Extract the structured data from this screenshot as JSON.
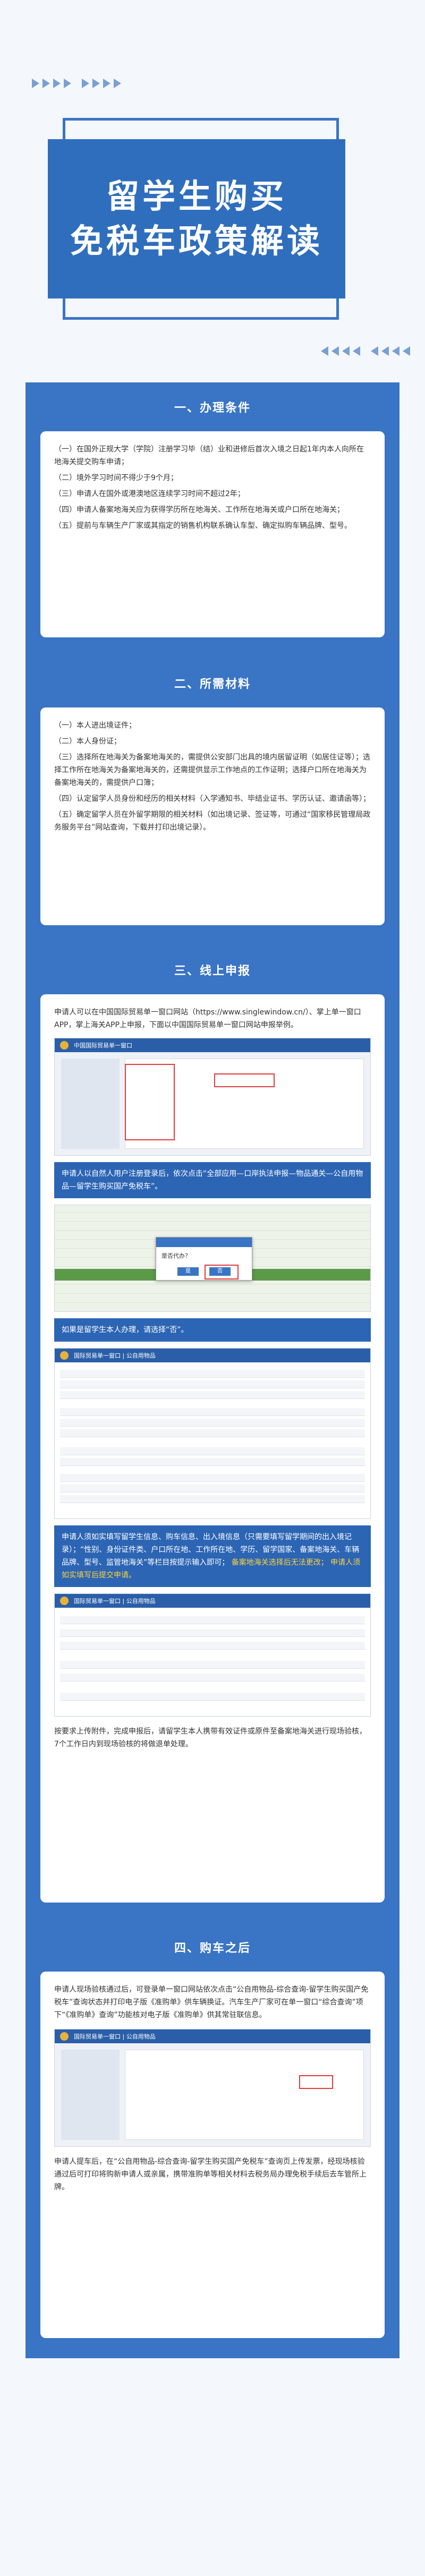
{
  "title": {
    "line1": "留学生购买",
    "line2": "免税车政策解读"
  },
  "sections": [
    {
      "heading": "一、办理条件",
      "paragraphs": [
        "（一）在国外正规大学（学院）注册学习毕（结）业和进修后首次入境之日起1年内本人向所在地海关提交购车申请；",
        "（二）境外学习时间不得少于9个月；",
        "（三）申请人在国外或港澳地区连续学习时间不超过2年；",
        "（四）申请人备案地海关应为获得学历所在地海关、工作所在地海关或户口所在地海关；",
        "（五）提前与车辆生产厂家或其指定的销售机构联系确认车型、确定拟购车辆品牌、型号。"
      ]
    },
    {
      "heading": "二、所需材料",
      "paragraphs": [
        "（一）本人进出境证件；",
        "（二）本人身份证；",
        "（三）选择所在地海关为备案地海关的，需提供公安部门出具的境内居留证明（如居住证等）；选择工作所在地海关为备案地海关的，还需提供显示工作地点的工作证明；选择户口所在地海关为备案地海关的，需提供户口簿；",
        "（四）认定留学人员身份和经历的相关材料（入学通知书、毕结业证书、学历认证、邀请函等）；",
        "（五）确定留学人员在外留学期限的相关材料（如出境记录、签证等，可通过“国家移民管理局政务服务平台”网站查询，下载并打印出境记录）。"
      ]
    },
    {
      "heading": "三、线上申报",
      "intro": "申请人可以在中国国际贸易单一窗口网站（https://www.singlewindow.cn/）、掌上单一窗口APP，掌上海关APP上申报，下面以中国国际贸易单一窗口网站申报举例。",
      "caption1": "申请人以自然人用户注册登录后，依次点击“全部应用—口岸执法申报—物品通关—公自用物品—留学生购买国产免税车”。",
      "caption2": "如果是留学生本人办理，请选择“否”。",
      "caption3_white": "申请人须如实填写留学生信息、购车信息、出入境信息（只需要填写留学期间的出入境记录）；“性别、身份证件类、户口所在地、工作所在地、学历、留学国家、备案地海关、车辆品牌、型号、监管地海关”等栏目按提示输入即可；",
      "caption3_yellow": "备案地海关选择后无法更改；",
      "caption3_yellow2": "申请人须如实填写后提交申请。",
      "outro": "按要求上传附件，完成申报后，请留学生本人携带有效证件或原件至备案地海关进行现场验核，7个工作日内到现场验核的将做退单处理。",
      "shot1_title": "中国国际贸易单一窗口",
      "shot3_title": "国际贸易单一窗口 | 公自用物品",
      "modal_text": "是否代办？",
      "modal_yes": "是",
      "modal_no": "否"
    },
    {
      "heading": "四、购车之后",
      "para1": "申请人现场验核通过后，可登录单一窗口网站依次点击“公自用物品-综合查询-留学生购买国产免税车”查询状态并打印电子版《准购单》供车辆换证。汽车生产厂家可在单一窗口“综合查询”项下“《准购单》查询”功能核对电子版《准购单》供其常驻联信息。",
      "para2": "申请人提车后，在“公自用物品-综合查询-留学生购买国产免税车”查询页上传发票，经现场核验通过后可打印将购新申请人或亲属，携带准购单等相关材料去税务局办理免税手续后去车管所上牌。",
      "shot4_title": "国际贸易单一窗口 | 公自用物品"
    }
  ],
  "colors": {
    "primary": "#3a74c4",
    "dark": "#2c65b4",
    "highlight": "#ffd23d",
    "red_box": "#e03b3b"
  }
}
